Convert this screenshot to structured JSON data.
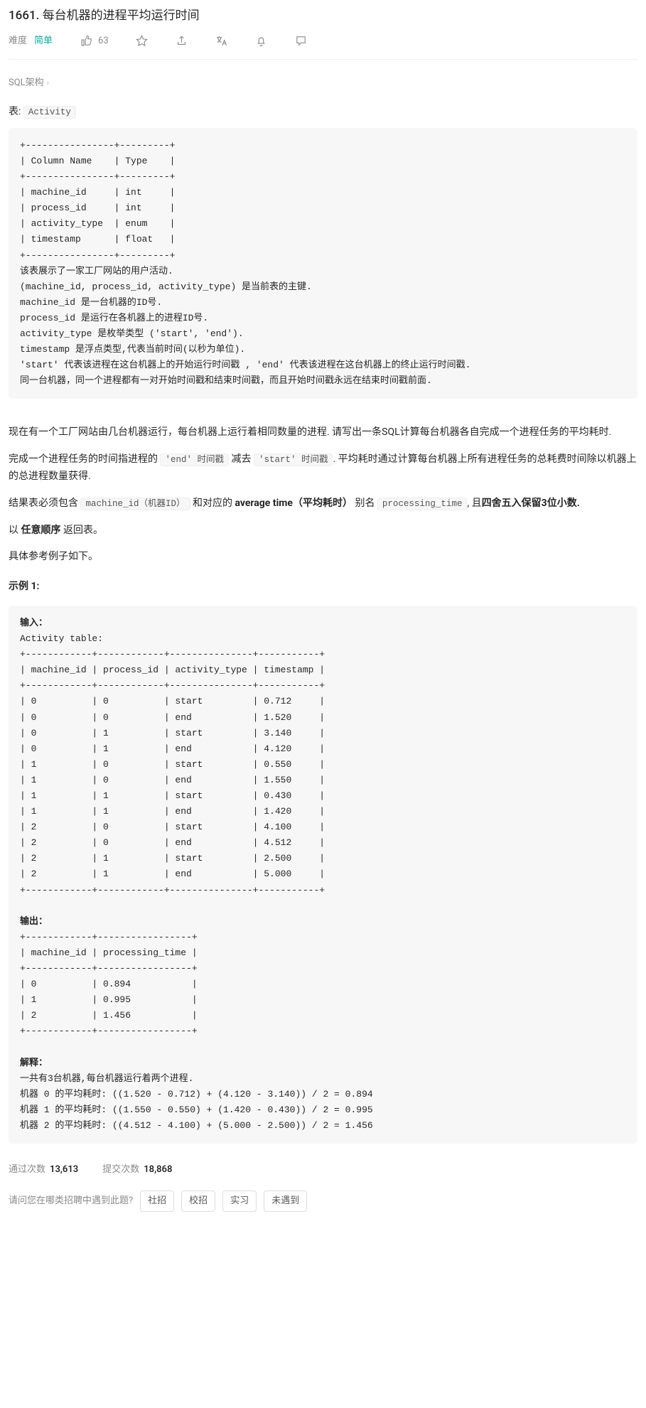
{
  "title": "1661. 每台机器的进程平均运行时间",
  "metabar": {
    "difficulty_label": "难度",
    "difficulty_value": "简单",
    "likes_count": "63"
  },
  "sql_schema_link": "SQL架构",
  "table_intro_prefix": "表: ",
  "table_name": "Activity",
  "schema_block": "+----------------+---------+\n| Column Name    | Type    |\n+----------------+---------+\n| machine_id     | int     |\n| process_id     | int     |\n| activity_type  | enum    |\n| timestamp      | float   |\n+----------------+---------+\n该表展示了一家工厂网站的用户活动.\n(machine_id, process_id, activity_type) 是当前表的主键.\nmachine_id 是一台机器的ID号.\nprocess_id 是运行在各机器上的进程ID号.\nactivity_type 是枚举类型 ('start', 'end').\ntimestamp 是浮点类型,代表当前时间(以秒为单位).\n'start' 代表该进程在这台机器上的开始运行时间戳 , 'end' 代表该进程在这台机器上的终止运行时间戳.\n同一台机器，同一个进程都有一对开始时间戳和结束时间戳，而且开始时间戳永远在结束时间戳前面.",
  "para1": "现在有一个工厂网站由几台机器运行，每台机器上运行着相同数量的进程. 请写出一条SQL计算每台机器各自完成一个进程任务的平均耗时.",
  "para2": {
    "t1": "完成一个进程任务的时间指进程的 ",
    "c1": "'end' 时间戳",
    "t2": " 减去 ",
    "c2": "'start' 时间戳",
    "t3": ". 平均耗时通过计算每台机器上所有进程任务的总耗费时间除以机器上的总进程数量获得."
  },
  "para3": {
    "t1": "结果表必须包含",
    "c1": "machine_id（机器ID）",
    "t2": " 和对应的 ",
    "b1": "average time（平均耗时）",
    "t3": " 别名 ",
    "c2": "processing_time",
    "t4": ", 且",
    "b2": "四舍五入保留3位小数."
  },
  "para4": {
    "t1": "以 ",
    "b1": "任意顺序",
    "t2": " 返回表。"
  },
  "para5": "具体参考例子如下。",
  "example_heading": "示例 1:",
  "example_block": "输入：\nActivity table:\n+------------+------------+---------------+-----------+\n| machine_id | process_id | activity_type | timestamp |\n+------------+------------+---------------+-----------+\n| 0          | 0          | start         | 0.712     |\n| 0          | 0          | end           | 1.520     |\n| 0          | 1          | start         | 3.140     |\n| 0          | 1          | end           | 4.120     |\n| 1          | 0          | start         | 0.550     |\n| 1          | 0          | end           | 1.550     |\n| 1          | 1          | start         | 0.430     |\n| 1          | 1          | end           | 1.420     |\n| 2          | 0          | start         | 4.100     |\n| 2          | 0          | end           | 4.512     |\n| 2          | 1          | start         | 2.500     |\n| 2          | 1          | end           | 5.000     |\n+------------+------------+---------------+-----------+\n\n输出：\n+------------+-----------------+\n| machine_id | processing_time |\n+------------+-----------------+\n| 0          | 0.894           |\n| 1          | 0.995           |\n| 2          | 1.456           |\n+------------+-----------------+\n\n解释：\n一共有3台机器,每台机器运行着两个进程.\n机器 0 的平均耗时: ((1.520 - 0.712) + (4.120 - 3.140)) / 2 = 0.894\n机器 1 的平均耗时: ((1.550 - 0.550) + (1.420 - 0.430)) / 2 = 0.995\n机器 2 的平均耗时: ((4.512 - 4.100) + (5.000 - 2.500)) / 2 = 1.456",
  "stats": {
    "accepted_label": "通过次数",
    "accepted_count": "13,613",
    "submissions_label": "提交次数",
    "submissions_count": "18,868"
  },
  "survey": {
    "question": "请问您在哪类招聘中遇到此题?",
    "opts": [
      "社招",
      "校招",
      "实习",
      "未遇到"
    ]
  }
}
